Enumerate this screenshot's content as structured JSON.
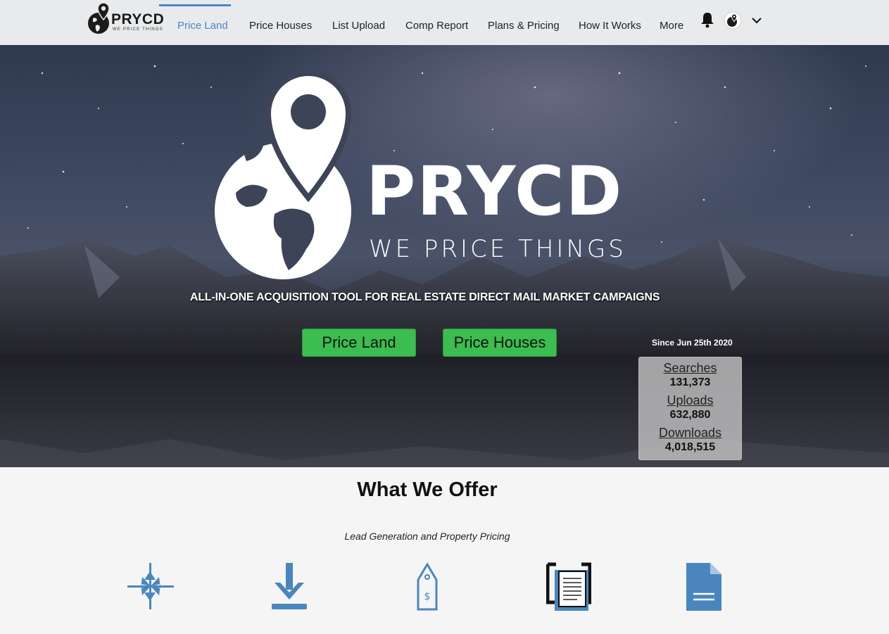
{
  "nav": {
    "brand_name": "PRYCD",
    "brand_tag": "WE PRICE THINGS",
    "items": [
      {
        "label": "Price Land",
        "active": true
      },
      {
        "label": "Price Houses"
      },
      {
        "label": "List Upload"
      },
      {
        "label": "Comp Report"
      },
      {
        "label": "Plans & Pricing"
      },
      {
        "label": "How It Works"
      },
      {
        "label": "More"
      }
    ],
    "icons": [
      "bell-icon",
      "globe-avatar-icon",
      "chevron-down-icon"
    ]
  },
  "hero": {
    "logo_name": "PRYCD",
    "logo_tag": "WE PRICE THINGS",
    "subtitle": "ALL-IN-ONE ACQUISITION TOOL FOR REAL ESTATE DIRECT MAIL MARKET CAMPAIGNS",
    "buttons": [
      "Price Land",
      "Price Houses"
    ],
    "since": "Since Jun 25th 2020",
    "stats": [
      {
        "label": "Searches",
        "value": "131,373"
      },
      {
        "label": "Uploads",
        "value": "632,880"
      },
      {
        "label": "Downloads",
        "value": "4,018,515"
      }
    ]
  },
  "offer": {
    "title": "What We Offer",
    "subtitle": "Lead Generation and Property Pricing",
    "icons": [
      "compress-arrows-icon",
      "download-icon",
      "price-tag-icon",
      "document-bracket-icon",
      "document-icon"
    ]
  },
  "colors": {
    "accent": "#4a88c5",
    "cta_green": "#3bbd4f",
    "icon_blue": "#4a86bd"
  }
}
